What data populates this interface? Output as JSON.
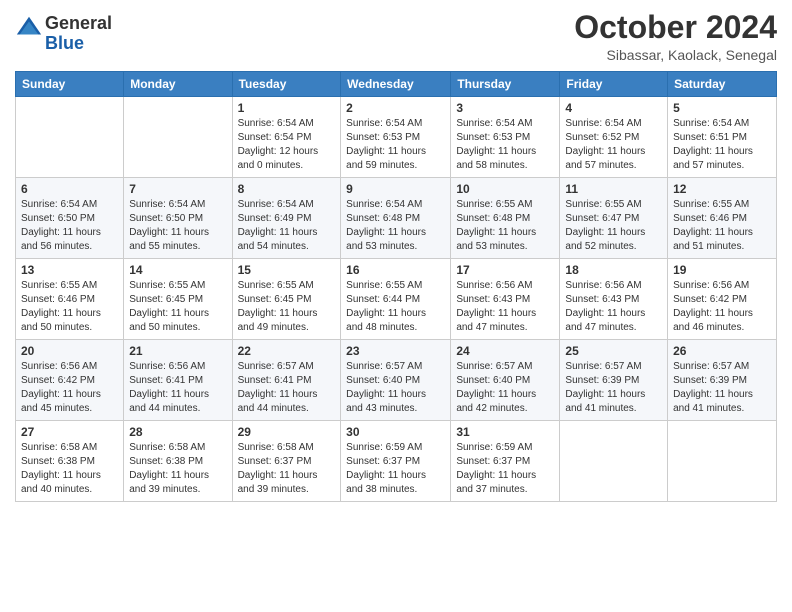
{
  "logo": {
    "general": "General",
    "blue": "Blue"
  },
  "title": "October 2024",
  "location": "Sibassar, Kaolack, Senegal",
  "headers": [
    "Sunday",
    "Monday",
    "Tuesday",
    "Wednesday",
    "Thursday",
    "Friday",
    "Saturday"
  ],
  "weeks": [
    [
      {
        "day": "",
        "detail": ""
      },
      {
        "day": "",
        "detail": ""
      },
      {
        "day": "1",
        "detail": "Sunrise: 6:54 AM\nSunset: 6:54 PM\nDaylight: 12 hours\nand 0 minutes."
      },
      {
        "day": "2",
        "detail": "Sunrise: 6:54 AM\nSunset: 6:53 PM\nDaylight: 11 hours\nand 59 minutes."
      },
      {
        "day": "3",
        "detail": "Sunrise: 6:54 AM\nSunset: 6:53 PM\nDaylight: 11 hours\nand 58 minutes."
      },
      {
        "day": "4",
        "detail": "Sunrise: 6:54 AM\nSunset: 6:52 PM\nDaylight: 11 hours\nand 57 minutes."
      },
      {
        "day": "5",
        "detail": "Sunrise: 6:54 AM\nSunset: 6:51 PM\nDaylight: 11 hours\nand 57 minutes."
      }
    ],
    [
      {
        "day": "6",
        "detail": "Sunrise: 6:54 AM\nSunset: 6:50 PM\nDaylight: 11 hours\nand 56 minutes."
      },
      {
        "day": "7",
        "detail": "Sunrise: 6:54 AM\nSunset: 6:50 PM\nDaylight: 11 hours\nand 55 minutes."
      },
      {
        "day": "8",
        "detail": "Sunrise: 6:54 AM\nSunset: 6:49 PM\nDaylight: 11 hours\nand 54 minutes."
      },
      {
        "day": "9",
        "detail": "Sunrise: 6:54 AM\nSunset: 6:48 PM\nDaylight: 11 hours\nand 53 minutes."
      },
      {
        "day": "10",
        "detail": "Sunrise: 6:55 AM\nSunset: 6:48 PM\nDaylight: 11 hours\nand 53 minutes."
      },
      {
        "day": "11",
        "detail": "Sunrise: 6:55 AM\nSunset: 6:47 PM\nDaylight: 11 hours\nand 52 minutes."
      },
      {
        "day": "12",
        "detail": "Sunrise: 6:55 AM\nSunset: 6:46 PM\nDaylight: 11 hours\nand 51 minutes."
      }
    ],
    [
      {
        "day": "13",
        "detail": "Sunrise: 6:55 AM\nSunset: 6:46 PM\nDaylight: 11 hours\nand 50 minutes."
      },
      {
        "day": "14",
        "detail": "Sunrise: 6:55 AM\nSunset: 6:45 PM\nDaylight: 11 hours\nand 50 minutes."
      },
      {
        "day": "15",
        "detail": "Sunrise: 6:55 AM\nSunset: 6:45 PM\nDaylight: 11 hours\nand 49 minutes."
      },
      {
        "day": "16",
        "detail": "Sunrise: 6:55 AM\nSunset: 6:44 PM\nDaylight: 11 hours\nand 48 minutes."
      },
      {
        "day": "17",
        "detail": "Sunrise: 6:56 AM\nSunset: 6:43 PM\nDaylight: 11 hours\nand 47 minutes."
      },
      {
        "day": "18",
        "detail": "Sunrise: 6:56 AM\nSunset: 6:43 PM\nDaylight: 11 hours\nand 47 minutes."
      },
      {
        "day": "19",
        "detail": "Sunrise: 6:56 AM\nSunset: 6:42 PM\nDaylight: 11 hours\nand 46 minutes."
      }
    ],
    [
      {
        "day": "20",
        "detail": "Sunrise: 6:56 AM\nSunset: 6:42 PM\nDaylight: 11 hours\nand 45 minutes."
      },
      {
        "day": "21",
        "detail": "Sunrise: 6:56 AM\nSunset: 6:41 PM\nDaylight: 11 hours\nand 44 minutes."
      },
      {
        "day": "22",
        "detail": "Sunrise: 6:57 AM\nSunset: 6:41 PM\nDaylight: 11 hours\nand 44 minutes."
      },
      {
        "day": "23",
        "detail": "Sunrise: 6:57 AM\nSunset: 6:40 PM\nDaylight: 11 hours\nand 43 minutes."
      },
      {
        "day": "24",
        "detail": "Sunrise: 6:57 AM\nSunset: 6:40 PM\nDaylight: 11 hours\nand 42 minutes."
      },
      {
        "day": "25",
        "detail": "Sunrise: 6:57 AM\nSunset: 6:39 PM\nDaylight: 11 hours\nand 41 minutes."
      },
      {
        "day": "26",
        "detail": "Sunrise: 6:57 AM\nSunset: 6:39 PM\nDaylight: 11 hours\nand 41 minutes."
      }
    ],
    [
      {
        "day": "27",
        "detail": "Sunrise: 6:58 AM\nSunset: 6:38 PM\nDaylight: 11 hours\nand 40 minutes."
      },
      {
        "day": "28",
        "detail": "Sunrise: 6:58 AM\nSunset: 6:38 PM\nDaylight: 11 hours\nand 39 minutes."
      },
      {
        "day": "29",
        "detail": "Sunrise: 6:58 AM\nSunset: 6:37 PM\nDaylight: 11 hours\nand 39 minutes."
      },
      {
        "day": "30",
        "detail": "Sunrise: 6:59 AM\nSunset: 6:37 PM\nDaylight: 11 hours\nand 38 minutes."
      },
      {
        "day": "31",
        "detail": "Sunrise: 6:59 AM\nSunset: 6:37 PM\nDaylight: 11 hours\nand 37 minutes."
      },
      {
        "day": "",
        "detail": ""
      },
      {
        "day": "",
        "detail": ""
      }
    ]
  ]
}
